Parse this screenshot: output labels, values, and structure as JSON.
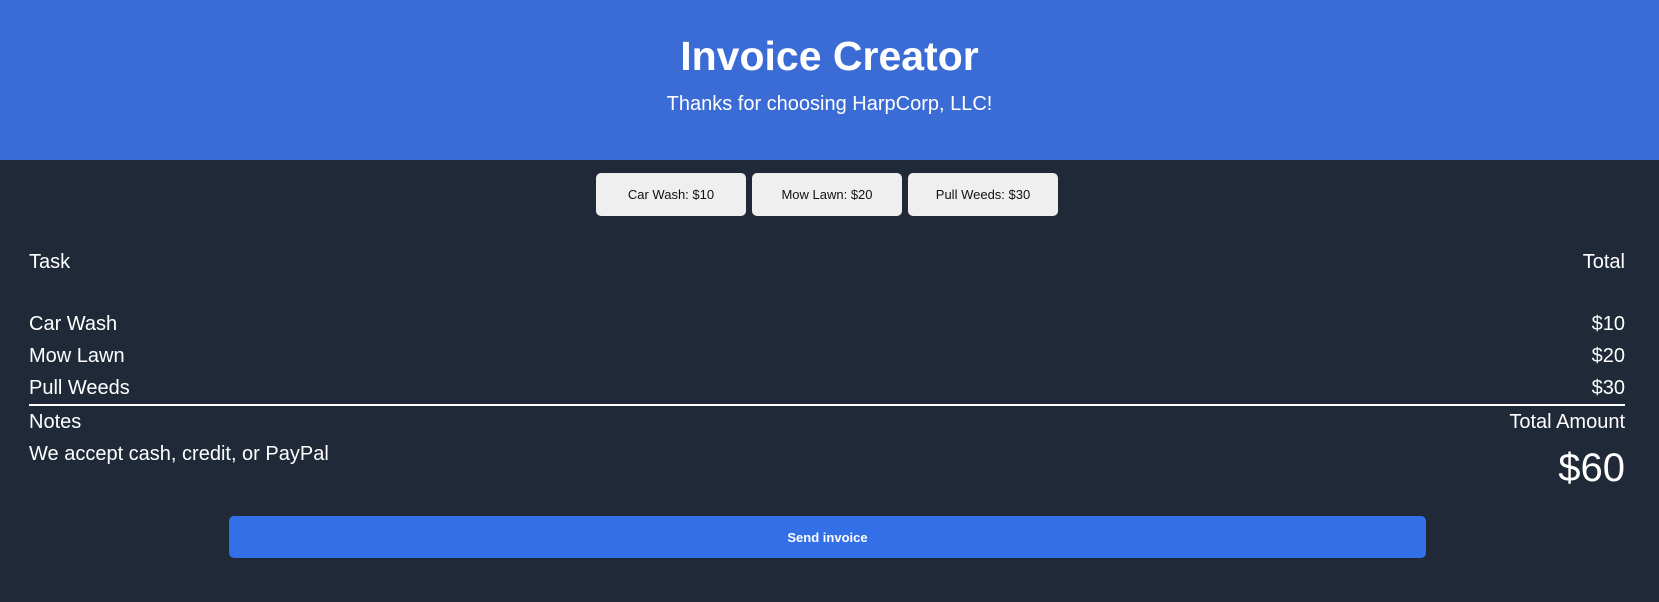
{
  "header": {
    "title": "Invoice Creator",
    "subtitle": "Thanks for choosing HarpCorp, LLC!"
  },
  "task_buttons": [
    {
      "label": "Car Wash: $10"
    },
    {
      "label": "Mow Lawn: $20"
    },
    {
      "label": "Pull Weeds: $30"
    }
  ],
  "table": {
    "task_header": "Task",
    "total_header": "Total",
    "items": [
      {
        "task": "Car Wash",
        "total": "$10"
      },
      {
        "task": "Mow Lawn",
        "total": "$20"
      },
      {
        "task": "Pull Weeds",
        "total": "$30"
      }
    ]
  },
  "summary": {
    "notes_label": "Notes",
    "notes_text": "We accept cash, credit, or PayPal",
    "total_label": "Total Amount",
    "total_value": "$60"
  },
  "send_button": {
    "label": "Send invoice"
  },
  "colors": {
    "header_bg": "#3b6bd4",
    "page_bg": "#1f2937",
    "button_bg": "#efefef",
    "send_bg": "#3370e8"
  }
}
